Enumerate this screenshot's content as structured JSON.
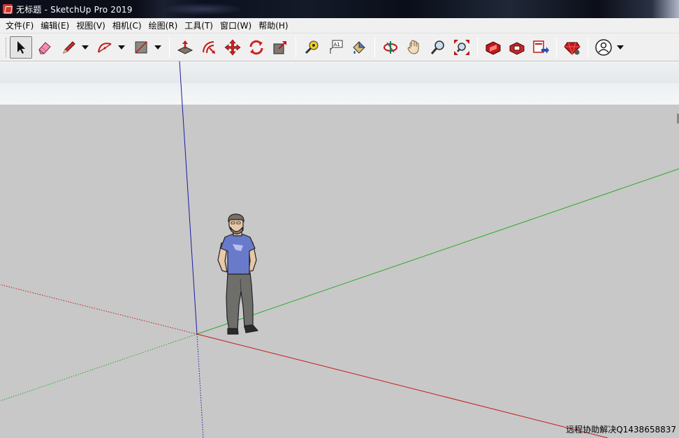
{
  "window": {
    "title": "无标题 - SketchUp Pro 2019",
    "app_icon": "sketchup-logo-icon"
  },
  "menu": {
    "items": [
      "文件(F)",
      "编辑(E)",
      "视图(V)",
      "相机(C)",
      "绘图(R)",
      "工具(T)",
      "窗口(W)",
      "帮助(H)"
    ]
  },
  "toolbar": {
    "tools": [
      {
        "name": "select-tool",
        "icon": "arrow-cursor-icon",
        "active": true
      },
      {
        "name": "eraser-tool",
        "icon": "eraser-icon"
      },
      {
        "name": "line-tool",
        "icon": "pencil-icon",
        "dropdown": true
      },
      {
        "name": "arc-tool",
        "icon": "arc-icon",
        "dropdown": true
      },
      {
        "name": "rectangle-tool",
        "icon": "rectangle-icon",
        "dropdown": true
      },
      {
        "name": "push-pull-tool",
        "icon": "push-pull-icon"
      },
      {
        "name": "offset-tool",
        "icon": "offset-icon"
      },
      {
        "name": "move-tool",
        "icon": "move-icon"
      },
      {
        "name": "rotate-tool",
        "icon": "rotate-icon"
      },
      {
        "name": "scale-tool",
        "icon": "scale-icon"
      },
      {
        "name": "tape-measure-tool",
        "icon": "tape-measure-icon"
      },
      {
        "name": "text-tool",
        "icon": "text-icon"
      },
      {
        "name": "paint-bucket-tool",
        "icon": "paint-bucket-icon"
      },
      {
        "name": "orbit-tool",
        "icon": "orbit-icon"
      },
      {
        "name": "pan-tool",
        "icon": "hand-icon"
      },
      {
        "name": "zoom-tool",
        "icon": "zoom-icon"
      },
      {
        "name": "zoom-extents-tool",
        "icon": "zoom-extents-icon"
      },
      {
        "name": "warehouse-tool",
        "icon": "3d-warehouse-icon"
      },
      {
        "name": "extension-warehouse-tool",
        "icon": "extension-warehouse-icon"
      },
      {
        "name": "send-to-layout-tool",
        "icon": "layout-icon"
      },
      {
        "name": "extension-manager-tool",
        "icon": "ruby-gem-icon"
      },
      {
        "name": "account-tool",
        "icon": "user-icon",
        "dropdown": true
      }
    ]
  },
  "viewport": {
    "axis_colors": {
      "blue": "#1a1aa0",
      "green": "#2aa82a",
      "red": "#c41a1a"
    },
    "background": "#c8c8c8",
    "sky": "#eef1f3"
  },
  "overlay": {
    "watermark": "远程协助解决Q1438658837"
  }
}
